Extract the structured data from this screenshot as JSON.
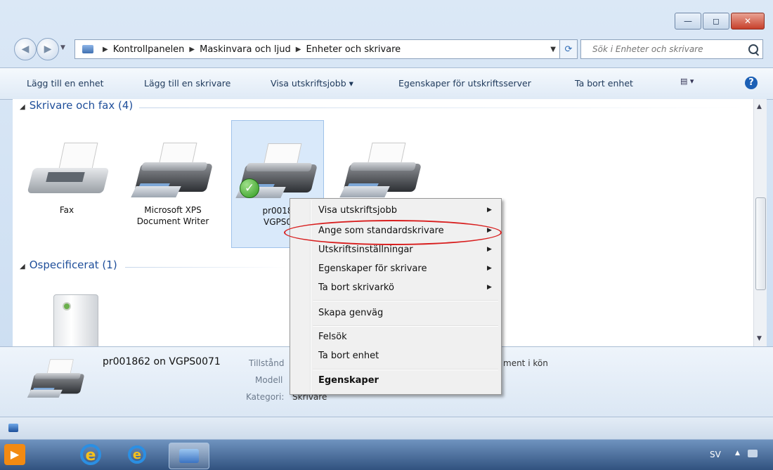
{
  "window": {
    "caption_buttons": {
      "minimize": "—",
      "maximize": "◻",
      "close": "✕"
    }
  },
  "address": {
    "breadcrumbs": [
      "Kontrollpanelen",
      "Maskinvara och ljud",
      "Enheter och skrivare"
    ],
    "search_placeholder": "Sök i Enheter och skrivare"
  },
  "commands": {
    "add_device": "Lägg till en enhet",
    "add_printer": "Lägg till en skrivare",
    "view_print_jobs": "Visa utskriftsjobb ▾",
    "print_server_props": "Egenskaper för utskriftsserver",
    "remove_device": "Ta bort enhet",
    "help": "?"
  },
  "groups": {
    "printers": {
      "header": "Skrivare och fax (4)"
    },
    "unspecified": {
      "header": "Ospecificerat (1)"
    }
  },
  "devices": [
    {
      "label": "Fax",
      "icon": "fax-icon"
    },
    {
      "label": "Microsoft XPS\nDocument Writer",
      "icon": "printer-icon"
    },
    {
      "label": "pr0018\nVGPS0",
      "icon": "printer-icon",
      "selected": true,
      "default": true
    },
    {
      "label": "",
      "icon": "printer-icon"
    }
  ],
  "context_menu": {
    "items": [
      {
        "label": "Visa utskriftsjobb",
        "submenu": true
      },
      {
        "label": "Ange som standardskrivare",
        "submenu": true,
        "highlighted": true
      },
      {
        "label": "Utskriftsinställningar",
        "submenu": true
      },
      {
        "label": "Egenskaper för skrivare",
        "submenu": true
      },
      {
        "label": "Ta bort skrivarkö",
        "submenu": true
      },
      {
        "label": "Skapa genväg",
        "submenu": false
      },
      {
        "label": "Felsök",
        "submenu": false
      },
      {
        "label": "Ta bort enhet",
        "submenu": false
      },
      {
        "label": "Egenskaper",
        "submenu": false,
        "bold": true
      }
    ]
  },
  "details": {
    "name": "pr001862 on VGPS0071",
    "state_label": "Tillstånd",
    "state_suffix": "ment i kön",
    "model_label": "Modell",
    "category_label": "Kategori:",
    "category_value": "Skrivare"
  },
  "taskbar": {
    "language": "SV",
    "tray_arrow": "▲"
  },
  "colors": {
    "highlight_ring": "#d81e1e",
    "accent": "#1e4e9a"
  }
}
